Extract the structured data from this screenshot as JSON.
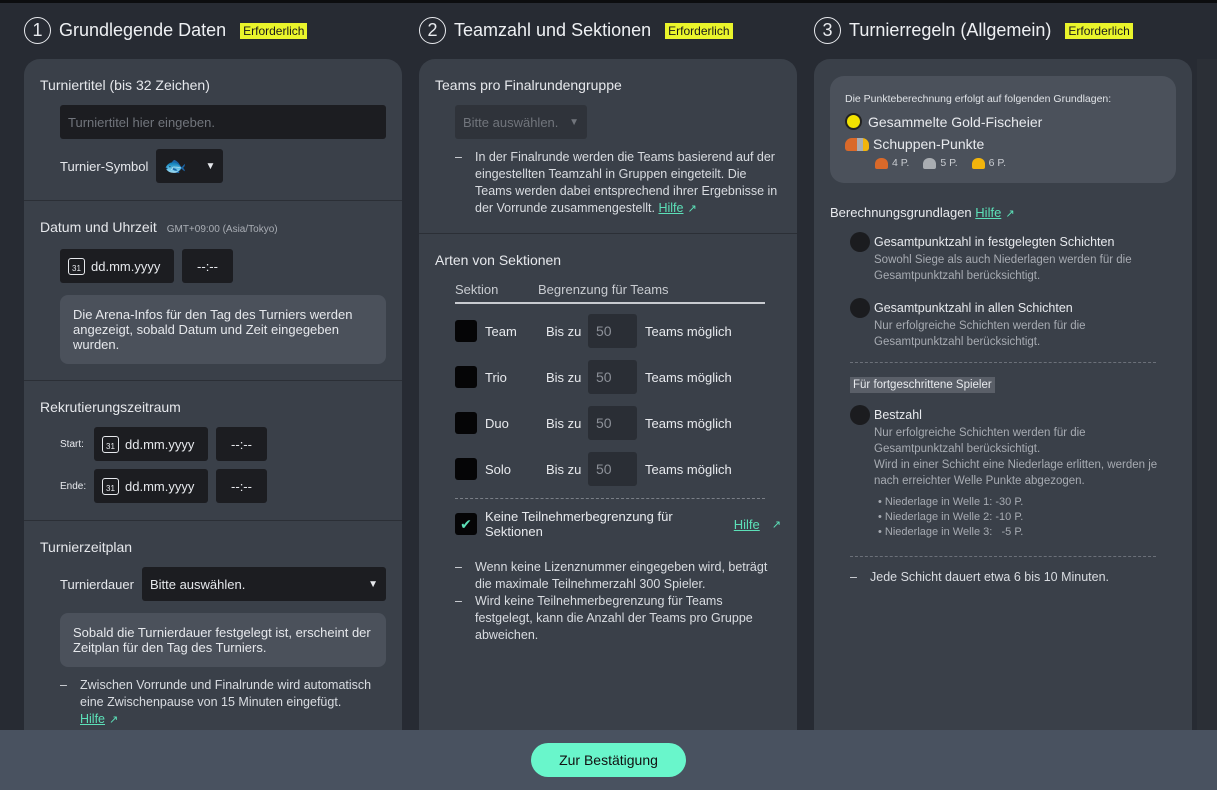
{
  "required_badge": "Erforderlich",
  "col1": {
    "num": "1",
    "title": "Grundlegende Daten",
    "title_label": "Turniertitel (bis 32 Zeichen)",
    "title_placeholder": "Turniertitel hier eingeben.",
    "symbol_label": "Turnier-Symbol",
    "datetime_label": "Datum und Uhrzeit",
    "timezone": "GMT+09:00 (Asia/Tokyo)",
    "date_placeholder": "dd.mm.yyyy",
    "time_placeholder": "--:--",
    "cal_day": "31",
    "arena_info": "Die Arena-Infos für den Tag des Turniers werden angezeigt, sobald Datum und Zeit eingegeben wurden.",
    "recruit_label": "Rekrutierungszeitraum",
    "start_label": "Start:",
    "end_label": "Ende:",
    "schedule_label": "Turnierzeitplan",
    "duration_label": "Turnierdauer",
    "duration_value": "Bitte auswählen.",
    "schedule_info": "Sobald die Turnierdauer festgelegt ist, erscheint der Zeitplan für den Tag des Turniers.",
    "pause_note": "Zwischen Vorrunde und Finalrunde wird automatisch eine Zwischenpause von 15 Minuten eingefügt.",
    "help": "Hilfe"
  },
  "col2": {
    "num": "2",
    "title": "Teamzahl und Sektionen",
    "teams_per_group_label": "Teams pro Finalrundengruppe",
    "teams_per_group_value": "Bitte auswählen.",
    "group_note": "In der Finalrunde werden die Teams basierend auf der eingestellten Teamzahl in Gruppen eingeteilt. Die Teams werden dabei entsprechend ihrer Ergebnisse in der Vorrunde zusammengestellt.",
    "help": "Hilfe",
    "sections_label": "Arten von Sektionen",
    "col_section": "Sektion",
    "col_limit": "Begrenzung für Teams",
    "rows": [
      {
        "name": "Team",
        "prefix": "Bis zu",
        "value": "50",
        "suffix": "Teams möglich",
        "checked": false
      },
      {
        "name": "Trio",
        "prefix": "Bis zu",
        "value": "50",
        "suffix": "Teams möglich",
        "checked": false
      },
      {
        "name": "Duo",
        "prefix": "Bis zu",
        "value": "50",
        "suffix": "Teams möglich",
        "checked": false
      },
      {
        "name": "Solo",
        "prefix": "Bis zu",
        "value": "50",
        "suffix": "Teams möglich",
        "checked": false
      }
    ],
    "no_limit_label": "Keine Teilnehmerbegrenzung für Sektionen",
    "no_limit_checked": true,
    "notes": [
      "Wenn keine Lizenznummer eingegeben wird, beträgt die maximale Teilnehmerzahl 300 Spieler.",
      "Wird keine Teilnehmerbegrenzung für Teams festgelegt, kann die Anzahl der Teams pro Gruppe abweichen."
    ]
  },
  "col3": {
    "num": "3",
    "title": "Turnierregeln (Allgemein)",
    "basis_intro": "Die Punkteberechnung erfolgt auf folgenden Grundlagen:",
    "gold": "Gesammelte Gold-Fischeier",
    "scales": "Schuppen-Punkte",
    "scale_points": [
      {
        "label": "4 P.",
        "color": "#d9692a"
      },
      {
        "label": "5 P.",
        "color": "#a9adb2"
      },
      {
        "label": "6 P.",
        "color": "#f2b40c"
      }
    ],
    "calc_label": "Berechnungsgrundlagen",
    "help": "Hilfe",
    "options": [
      {
        "title": "Gesamtpunktzahl in festgelegten Schichten",
        "desc": "Sowohl Siege als auch Niederlagen werden für die Gesamtpunktzahl berücksichtigt."
      },
      {
        "title": "Gesamtpunktzahl in allen Schichten",
        "desc": "Nur erfolgreiche Schichten werden für die Gesamtpunktzahl berücksichtigt."
      }
    ],
    "advanced_label": "Für fortgeschrittene Spieler",
    "best": {
      "title": "Bestzahl",
      "desc": "Nur erfolgreiche Schichten werden für die Gesamtpunktzahl berücksichtigt.",
      "desc2": "Wird in einer Schicht eine Niederlage erlitten, werden je nach erreichter Welle Punkte abgezogen.",
      "penalties": [
        "Niederlage in Welle 1: -30 P.",
        "Niederlage in Welle 2: -10 P.",
        "Niederlage in Welle 3:   -5 P."
      ]
    },
    "shift_note": "Jede Schicht dauert etwa 6 bis 10 Minuten."
  },
  "footer": {
    "confirm": "Zur Bestätigung"
  },
  "colors": {
    "accent": "#69f6cb",
    "badge": "#eaf52b",
    "link": "#5ce0b8"
  }
}
